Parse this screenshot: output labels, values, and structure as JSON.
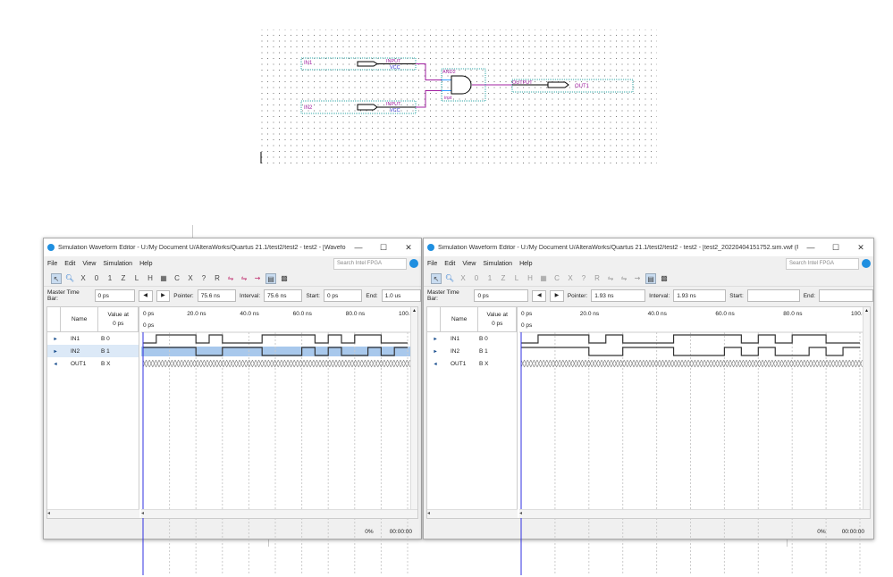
{
  "schematic": {
    "in1": {
      "name": "IN1",
      "type": "INPUT",
      "default": "VCC"
    },
    "in2": {
      "name": "IN2",
      "type": "INPUT",
      "default": "VCC"
    },
    "gate": {
      "type": "AND2",
      "instance": "inst"
    },
    "out1": {
      "name": "OUT1",
      "type": "OUTPUT"
    }
  },
  "windows": [
    {
      "title": "Simulation Waveform Editor - U:/My Document U/AlteraWorks/Quartus 21.1/test2/test2 - test2 - [Waveform.vwf]",
      "menu": [
        "File",
        "Edit",
        "View",
        "Simulation",
        "Help"
      ],
      "search_placeholder": "Search Intel FPGA",
      "master_time_bar_label": "Master Time Bar:",
      "master_time_bar": "0 ps",
      "pointer_label": "Pointer:",
      "pointer": "75.6 ns",
      "interval_label": "Interval:",
      "interval": "75.6 ns",
      "start_label": "Start:",
      "start": "0 ps",
      "end_label": "End:",
      "end": "1.0 us",
      "col_name": "Name",
      "col_value": "Value at",
      "col_value_time": "0 ps",
      "time_ticks": [
        "0 ps",
        "20.0 ns",
        "40.0 ns",
        "60.0 ns",
        "80.0 ns",
        "100.0 ns"
      ],
      "cursor_label": "0 ps",
      "signals": [
        {
          "name": "IN1",
          "value": "B 0",
          "dir": "in"
        },
        {
          "name": "IN2",
          "value": "B 1",
          "dir": "in",
          "selected": true
        },
        {
          "name": "OUT1",
          "value": "B X",
          "dir": "out"
        }
      ],
      "progress": "0%",
      "elapsed": "00:00:00"
    },
    {
      "title": "Simulation Waveform Editor - U:/My Document U/AlteraWorks/Quartus 21.1/test2/test2 - test2 - [test2_20220404151752.sim.vwf (Read-Only)]",
      "menu": [
        "File",
        "Edit",
        "View",
        "Simulation",
        "Help"
      ],
      "search_placeholder": "Search Intel FPGA",
      "master_time_bar_label": "Master Time Bar:",
      "master_time_bar": "0 ps",
      "pointer_label": "Pointer:",
      "pointer": "1.93 ns",
      "interval_label": "Interval:",
      "interval": "1.93 ns",
      "start_label": "Start:",
      "start": "",
      "end_label": "End:",
      "end": "",
      "col_name": "Name",
      "col_value": "Value at",
      "col_value_time": "0 ps",
      "time_ticks": [
        "0 ps",
        "20.0 ns",
        "40.0 ns",
        "60.0 ns",
        "80.0 ns",
        "100.0 ns"
      ],
      "cursor_label": "0 ps",
      "signals": [
        {
          "name": "IN1",
          "value": "B 0",
          "dir": "in"
        },
        {
          "name": "IN2",
          "value": "B 1",
          "dir": "in"
        },
        {
          "name": "OUT1",
          "value": "B X",
          "dir": "out"
        }
      ],
      "progress": "0%",
      "elapsed": "00:00:00"
    }
  ],
  "waveforms": {
    "step_ns": 5,
    "range_ns": [
      0,
      100
    ],
    "IN1": [
      0,
      1,
      1,
      1,
      0,
      1,
      0,
      0,
      0,
      1,
      1,
      1,
      1,
      0,
      1,
      0,
      1,
      1,
      0,
      0
    ],
    "IN2": [
      1,
      1,
      1,
      1,
      0,
      0,
      1,
      1,
      1,
      0,
      0,
      0,
      1,
      0,
      1,
      0,
      0,
      1,
      0,
      1
    ],
    "OUT1": "X"
  },
  "colors": {
    "wire": "#a020a0",
    "label": "#a020a0",
    "vcc": "#3030d0",
    "selection": "#a8c8ec",
    "cursor": "#3030e0"
  }
}
